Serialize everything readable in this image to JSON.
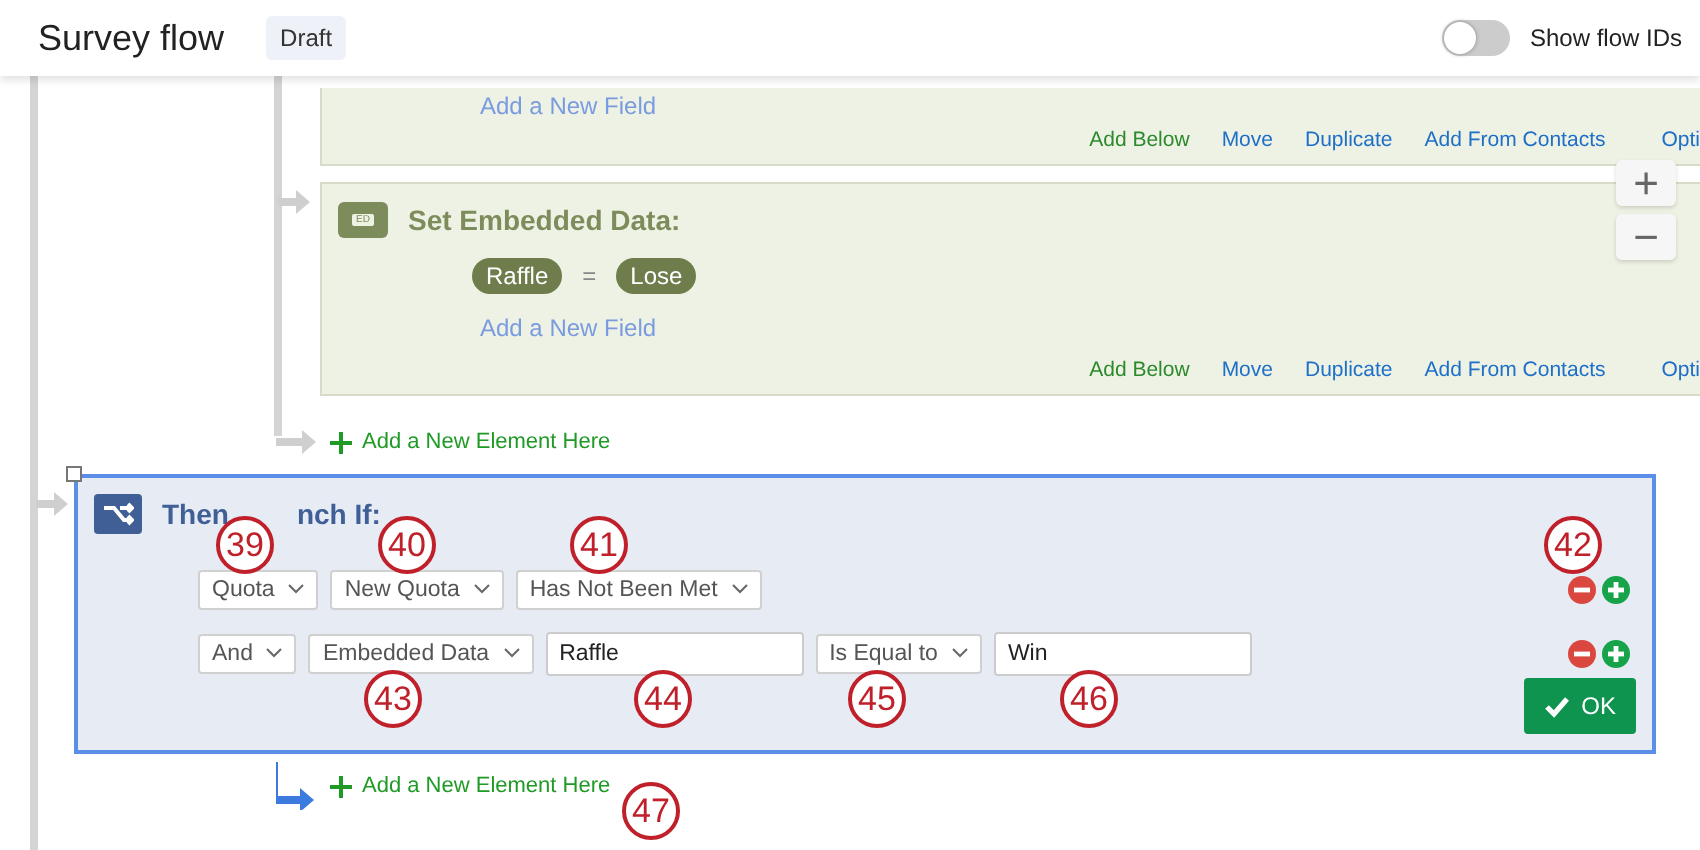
{
  "header": {
    "title": "Survey flow",
    "status": "Draft",
    "toggle": {
      "label": "Show flow IDs",
      "on": false
    }
  },
  "top_block": {
    "add_field": "Add a New Field",
    "actions": [
      "Add Below",
      "Move",
      "Duplicate",
      "Add From Contacts",
      "Opti"
    ]
  },
  "embedded_block": {
    "title": "Set Embedded Data:",
    "icon_label": "ED",
    "field": "Raffle",
    "operator": "=",
    "value": "Lose",
    "add_field": "Add a New Field",
    "actions": [
      "Add Below",
      "Move",
      "Duplicate",
      "Add From Contacts",
      "Opti"
    ]
  },
  "add_element_1": "Add a New Element Here",
  "branch": {
    "title_parts": [
      "Then",
      "nch If:"
    ],
    "rows": [
      {
        "selects": [
          "Quota",
          "New Quota",
          "Has Not Been Met"
        ],
        "inputs": []
      },
      {
        "selects": [
          "And",
          "Embedded Data"
        ],
        "inputs": [
          "Raffle"
        ],
        "select_after": "Is Equal to",
        "value": "Win"
      }
    ],
    "ok": "OK"
  },
  "add_element_2": "Add a New Element Here",
  "zoom": {
    "plus": "+",
    "minus": "−"
  },
  "callouts": [
    "39",
    "40",
    "41",
    "42",
    "43",
    "44",
    "45",
    "46",
    "47"
  ]
}
